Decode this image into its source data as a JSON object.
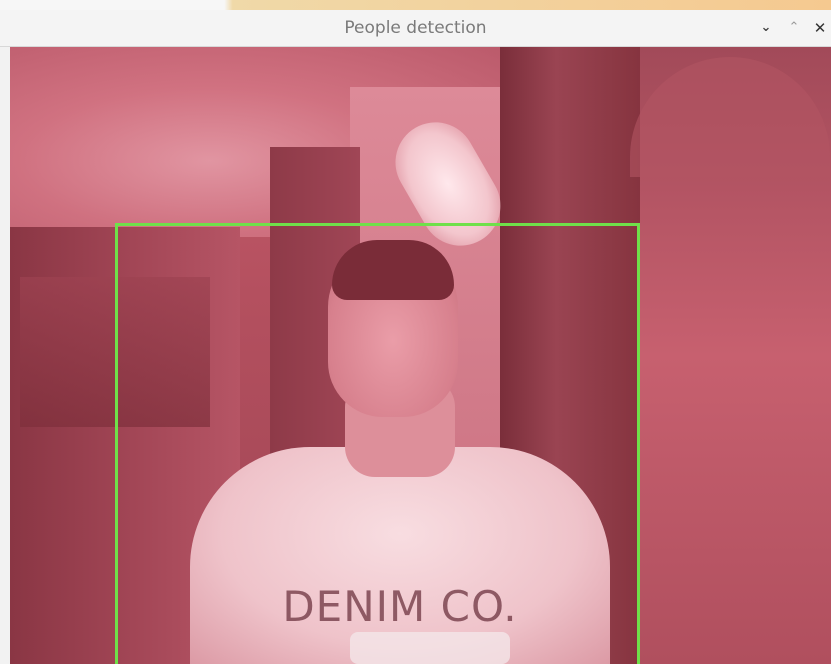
{
  "window": {
    "title": "People detection",
    "controls": {
      "minimize": "⌄",
      "maximize": "⌃",
      "close": "✕"
    }
  },
  "video": {
    "tint_color": "#b8515f",
    "shirt_text": "DENIM CO."
  },
  "detection": {
    "box_color": "#6fe04a",
    "count": 1
  }
}
